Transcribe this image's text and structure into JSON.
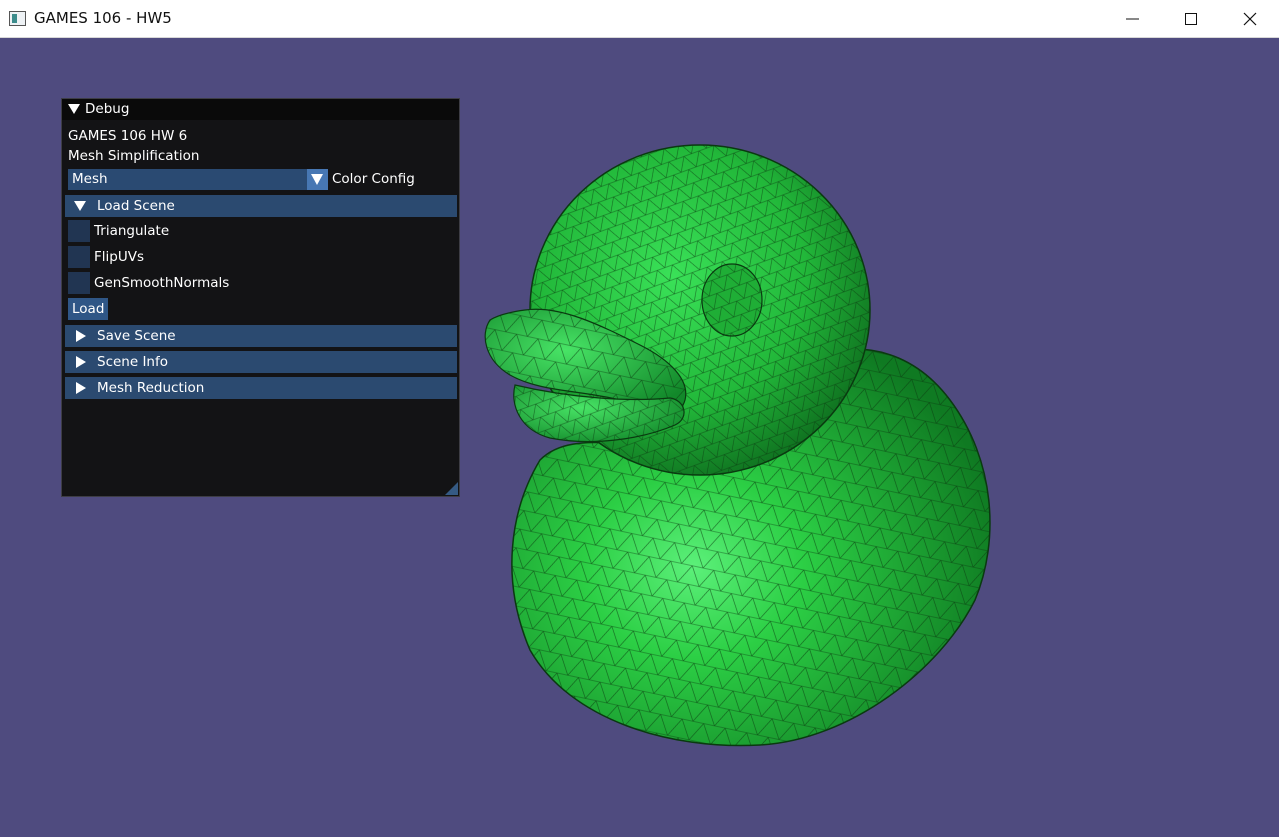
{
  "window": {
    "title": "GAMES 106 - HW5",
    "controls": [
      "minimize-icon",
      "maximize-icon",
      "close-icon"
    ]
  },
  "viewport": {
    "background_color": "#4f4b7f",
    "mesh_color": "#22c43d",
    "wire_color": "#0a3a10"
  },
  "debug_panel": {
    "title": "Debug",
    "line1": "GAMES 106 HW 6",
    "line2": "Mesh Simplification",
    "combo_value": "Mesh",
    "combo_label": "Color Config",
    "sections": {
      "load_scene": {
        "label": "Load Scene",
        "expanded": true,
        "checkboxes": [
          {
            "label": "Triangulate",
            "checked": false
          },
          {
            "label": "FlipUVs",
            "checked": false
          },
          {
            "label": "GenSmoothNormals",
            "checked": false
          }
        ],
        "button": "Load"
      },
      "save_scene": {
        "label": "Save Scene",
        "expanded": false
      },
      "scene_info": {
        "label": "Scene Info",
        "expanded": false
      },
      "mesh_reduction": {
        "label": "Mesh Reduction",
        "expanded": false
      }
    }
  }
}
